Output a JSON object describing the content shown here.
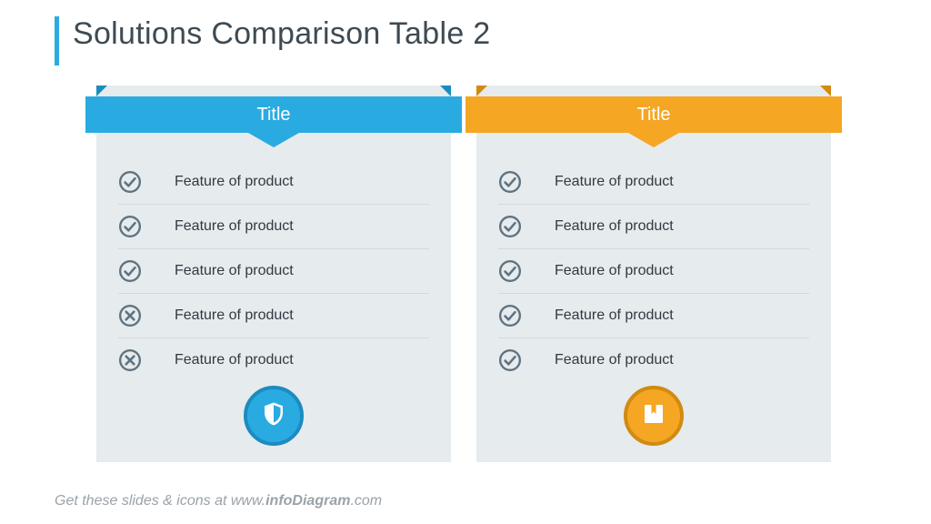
{
  "title": "Solutions Comparison Table 2",
  "footer": {
    "prefix": "Get these slides & icons at www.",
    "bold": "infoDiagram",
    "suffix": ".com"
  },
  "colors": {
    "blue": "#29abe2",
    "blue_dark": "#1c8bc0",
    "orange": "#f5a623",
    "orange_dark": "#d28a12",
    "icon_stroke": "#5f7380"
  },
  "cards": [
    {
      "title": "Title",
      "accent": "blue",
      "badge_icon": "shield",
      "features": [
        {
          "label": "Feature of product",
          "has": true
        },
        {
          "label": "Feature of product",
          "has": true
        },
        {
          "label": "Feature of product",
          "has": true
        },
        {
          "label": "Feature of product",
          "has": false
        },
        {
          "label": "Feature of product",
          "has": false
        }
      ]
    },
    {
      "title": "Title",
      "accent": "orange",
      "badge_icon": "bookmark-box",
      "features": [
        {
          "label": "Feature of product",
          "has": true
        },
        {
          "label": "Feature of product",
          "has": true
        },
        {
          "label": "Feature of product",
          "has": true
        },
        {
          "label": "Feature of product",
          "has": true
        },
        {
          "label": "Feature of product",
          "has": true
        }
      ]
    }
  ]
}
